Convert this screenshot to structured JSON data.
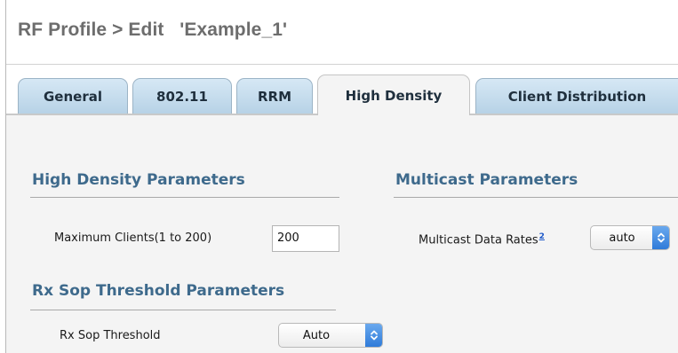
{
  "page": {
    "title": "RF Profile > Edit   'Example_1'"
  },
  "tabs": [
    {
      "label": "General",
      "active": false
    },
    {
      "label": "802.11",
      "active": false
    },
    {
      "label": "RRM",
      "active": false
    },
    {
      "label": "High Density",
      "active": true
    },
    {
      "label": "Client Distribution",
      "active": false
    }
  ],
  "high_density": {
    "title": "High Density Parameters",
    "max_clients_label": "Maximum Clients(1 to 200)",
    "max_clients_value": "200"
  },
  "multicast": {
    "title": "Multicast Parameters",
    "data_rates_label": "Multicast Data Rates",
    "data_rates_footnote": "2",
    "data_rates_value": "auto"
  },
  "rx_sop": {
    "title": "Rx Sop Threshold Parameters",
    "threshold_label": "Rx Sop Threshold",
    "threshold_value": "Auto"
  },
  "colors": {
    "section_title": "#3e6a8c",
    "tab_inactive": "#c6dcee",
    "tab_active": "#f4f4f4",
    "select_button": "#3c86e0"
  },
  "icons": {
    "select_arrows": "updown-chevron-icon"
  }
}
